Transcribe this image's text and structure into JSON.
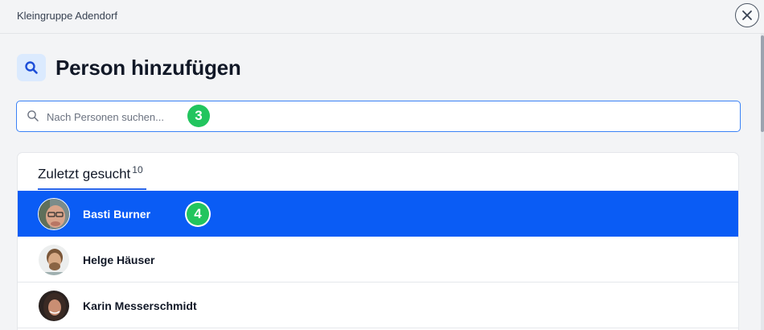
{
  "header": {
    "group_name": "Kleingruppe Adendorf",
    "close_icon": "close-icon"
  },
  "title": {
    "icon": "search-icon",
    "text": "Person hinzufügen"
  },
  "search": {
    "placeholder": "Nach Personen suchen...",
    "value": ""
  },
  "markers": {
    "search_step": "3",
    "row_step": "4"
  },
  "recent": {
    "tab_label": "Zuletzt gesucht",
    "tab_count": "10",
    "people": [
      {
        "name": "Basti Burner",
        "selected": true,
        "avatar": "avatar-basti"
      },
      {
        "name": "Helge Häuser",
        "selected": false,
        "avatar": "avatar-helge"
      },
      {
        "name": "Karin Messerschmidt",
        "selected": false,
        "avatar": "avatar-karin"
      }
    ]
  },
  "colors": {
    "accent": "#0a5cf5",
    "focus_border": "#3b82f6",
    "marker": "#22c55e"
  }
}
